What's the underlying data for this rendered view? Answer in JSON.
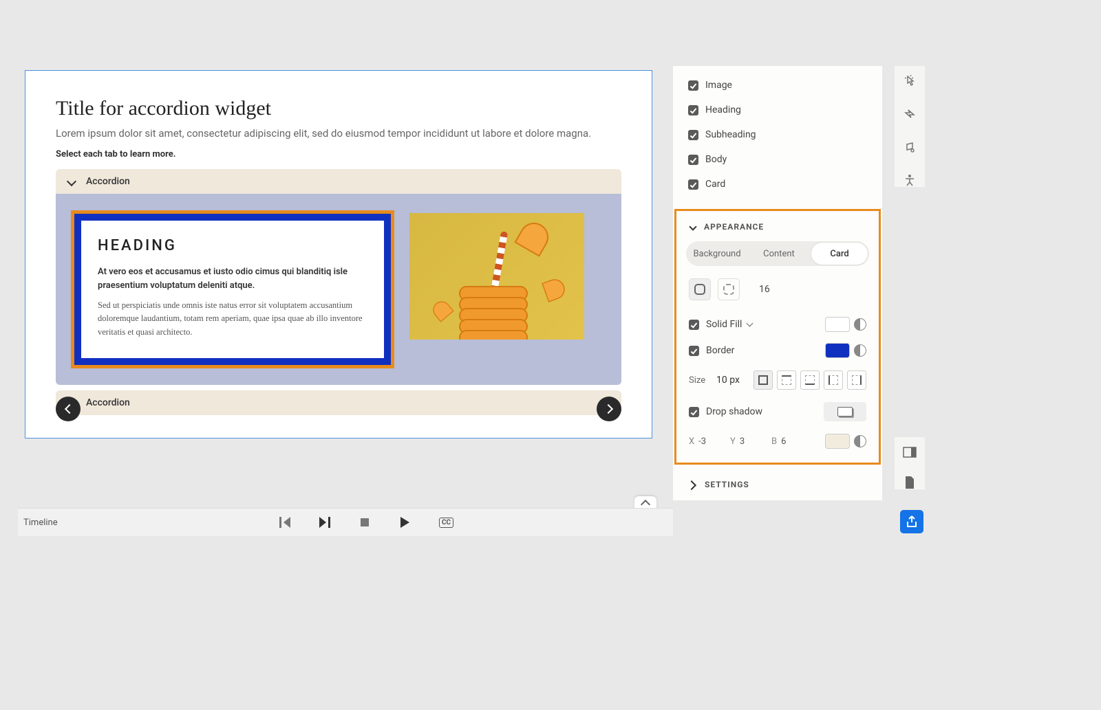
{
  "canvas": {
    "widget_title": "Title for accordion widget",
    "widget_subtitle": "Lorem ipsum dolor sit amet, consectetur adipiscing elit, sed do eiusmod tempor incididunt ut labore et dolore magna.",
    "instruction": "Select each tab to learn more.",
    "accordion_items": [
      {
        "label": "Accordion",
        "expanded": true
      },
      {
        "label": "Accordion",
        "expanded": false
      }
    ],
    "card": {
      "heading": "HEADING",
      "para1": "At vero eos et accusamus et iusto odio cimus qui blanditiq isle praesentium voluptatum deleniti atque.",
      "para2": "Sed ut perspiciatis unde omnis iste natus error sit voluptatem accusantium doloremque laudantium, totam rem aperiam, quae ipsa quae ab illo inventore veritatis et quasi architecto."
    }
  },
  "timeline": {
    "label": "Timeline",
    "cc": "CC"
  },
  "panel": {
    "components": {
      "image": "Image",
      "heading": "Heading",
      "subheading": "Subheading",
      "body": "Body",
      "card": "Card"
    },
    "appearance": {
      "section_label": "APPEARANCE",
      "tabs": {
        "background": "Background",
        "content": "Content",
        "card": "Card"
      },
      "corner_radius_value": "16",
      "solid_fill_label": "Solid Fill",
      "solid_fill_color": "#ffffff",
      "border_label": "Border",
      "border_color": "#1030c0",
      "size_label": "Size",
      "size_value": "10 px",
      "drop_shadow_label": "Drop shadow",
      "shadow_x_label": "X",
      "shadow_x": "-3",
      "shadow_y_label": "Y",
      "shadow_y": "3",
      "shadow_b_label": "B",
      "shadow_b": "6",
      "shadow_color": "#f2ecde"
    },
    "settings_label": "SETTINGS"
  }
}
